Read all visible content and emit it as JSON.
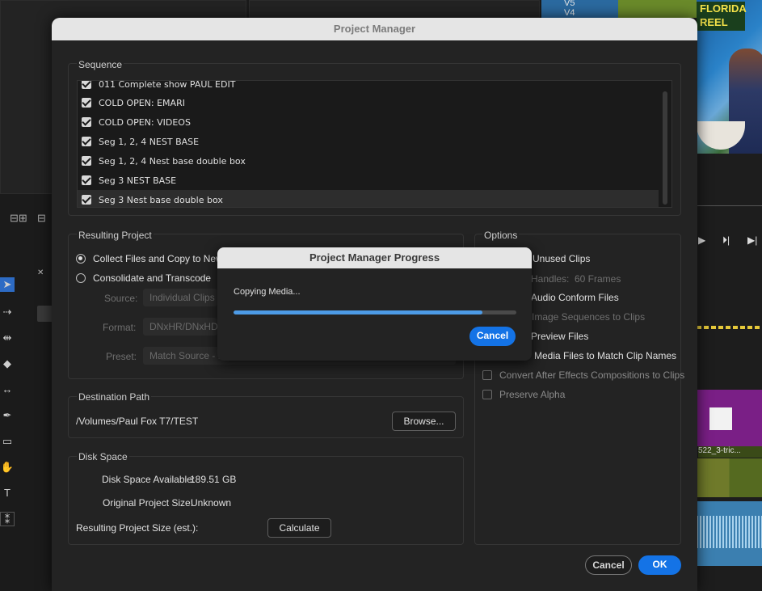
{
  "background": {
    "video_labels": [
      "V5",
      "V4"
    ],
    "logo_text": [
      "FLORIDA",
      "REEL"
    ],
    "clip_name": "522_3-tric..."
  },
  "dialog": {
    "title": "Project Manager",
    "sequence": {
      "label": "Sequence",
      "items": [
        {
          "label": "011 Complete show PAUL EDIT",
          "checked": true
        },
        {
          "label": "COLD OPEN: EMARI",
          "checked": true
        },
        {
          "label": "COLD OPEN: VIDEOS",
          "checked": true
        },
        {
          "label": "Seg 1, 2, 4 NEST BASE",
          "checked": true
        },
        {
          "label": "Seg 1, 2, 4 Nest base double box",
          "checked": true
        },
        {
          "label": "Seg 3 NEST BASE",
          "checked": true
        },
        {
          "label": "Seg 3 Nest base double box",
          "checked": true
        }
      ]
    },
    "resulting_project": {
      "label": "Resulting Project",
      "option_collect": "Collect Files and Copy to New L",
      "option_consolidate": "Consolidate and Transcode",
      "source_label": "Source:",
      "source_value": "Individual Clips",
      "format_label": "Format:",
      "format_value": "DNxHR/DNxHD M",
      "preset_label": "Preset:",
      "preset_value": "Match Source - D"
    },
    "options": {
      "label": "Options",
      "unused_clips": "Unused Clips",
      "handles_label": "Handles:",
      "handles_value": "60 Frames",
      "audio_conform": "Audio Conform Files",
      "image_sequences": "Image Sequences to Clips",
      "preview_files": "Preview Files",
      "rename_media": "Media Files to Match Clip Names",
      "convert_ae": "Convert After Effects Compositions to Clips",
      "preserve_alpha": "Preserve Alpha"
    },
    "destination": {
      "label": "Destination Path",
      "path": "/Volumes/Paul Fox T7/TEST",
      "browse": "Browse..."
    },
    "disk_space": {
      "label": "Disk Space",
      "available_label": "Disk Space Available:",
      "available_value": "189.51 GB",
      "original_label": "Original Project Size:",
      "original_value": "Unknown",
      "resulting_label": "Resulting Project Size (est.):",
      "calculate": "Calculate"
    },
    "cancel": "Cancel",
    "ok": "OK"
  },
  "progress": {
    "title": "Project Manager Progress",
    "status": "Copying Media...",
    "fraction": 0.88,
    "cancel": "Cancel",
    "accent": "#1473e6"
  }
}
